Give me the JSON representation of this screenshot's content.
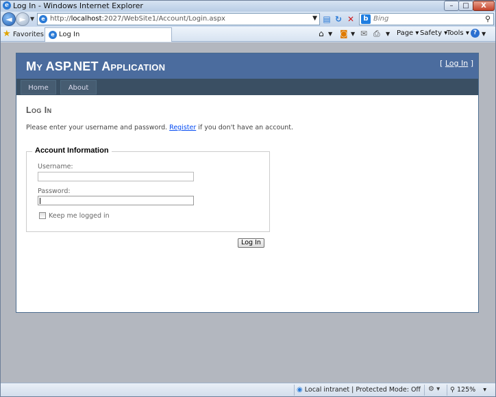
{
  "window": {
    "title": "Log In - Windows Internet Explorer",
    "minimize_glyph": "–",
    "maximize_glyph": "□",
    "close_glyph": "X"
  },
  "navbar": {
    "back_glyph": "◄",
    "forward_glyph": "►",
    "address_prefix": "http://",
    "address_host": "localhost",
    "address_rest": ":2027/WebSite1/Account/Login.aspx",
    "search_placeholder": "Bing",
    "search_provider_glyph": "b"
  },
  "favbar": {
    "favorites_label": "Favorites",
    "tab_label": "Log In",
    "page_menu": "Page",
    "safety_menu": "Safety",
    "tools_menu": "Tools",
    "help_glyph": "?"
  },
  "site": {
    "title": "My ASP.NET Application",
    "login_open": "[ ",
    "login_link": "Log In",
    "login_close": " ]",
    "menu": [
      {
        "label": "Home"
      },
      {
        "label": "About"
      }
    ]
  },
  "login": {
    "heading": "Log In",
    "instructions_before": "Please enter your username and password. ",
    "register_link": "Register",
    "instructions_after": " if you don't have an account.",
    "legend": "Account Information",
    "username_label": "Username:",
    "password_label": "Password:",
    "remember_label": "Keep me logged in",
    "submit_label": "Log In"
  },
  "status": {
    "zone_text": "Local intranet | Protected Mode: Off",
    "zoom": "125%"
  },
  "colors": {
    "header_bg": "#4b6c9e",
    "menubar_bg": "#3a4f63",
    "link": "#034af3"
  }
}
